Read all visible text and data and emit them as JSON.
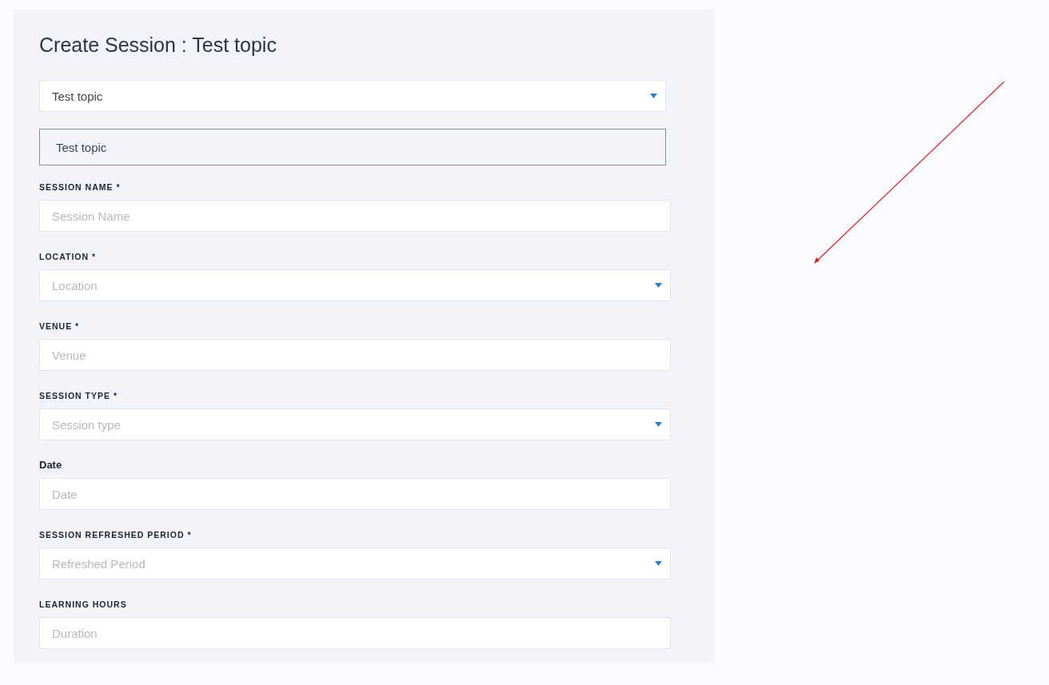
{
  "title": "Create Session : Test topic",
  "topic_select": {
    "value": "Test topic"
  },
  "topic_box": {
    "value": "Test topic"
  },
  "fields": [
    {
      "label": "SESSION NAME *",
      "label_caps": true,
      "kind": "input",
      "placeholder": "Session Name"
    },
    {
      "label": "LOCATION *",
      "label_caps": true,
      "kind": "select",
      "placeholder": "Location"
    },
    {
      "label": "VENUE *",
      "label_caps": true,
      "kind": "input",
      "placeholder": "Venue"
    },
    {
      "label": "SESSION TYPE *",
      "label_caps": true,
      "kind": "select",
      "placeholder": "Session type"
    },
    {
      "label": "Date",
      "label_caps": false,
      "kind": "input",
      "placeholder": "Date"
    },
    {
      "label": "SESSION REFRESHED PERIOD *",
      "label_caps": true,
      "kind": "select",
      "placeholder": "Refreshed Period"
    },
    {
      "label": "LEARNING HOURS",
      "label_caps": true,
      "kind": "input",
      "placeholder": "Duration"
    }
  ]
}
